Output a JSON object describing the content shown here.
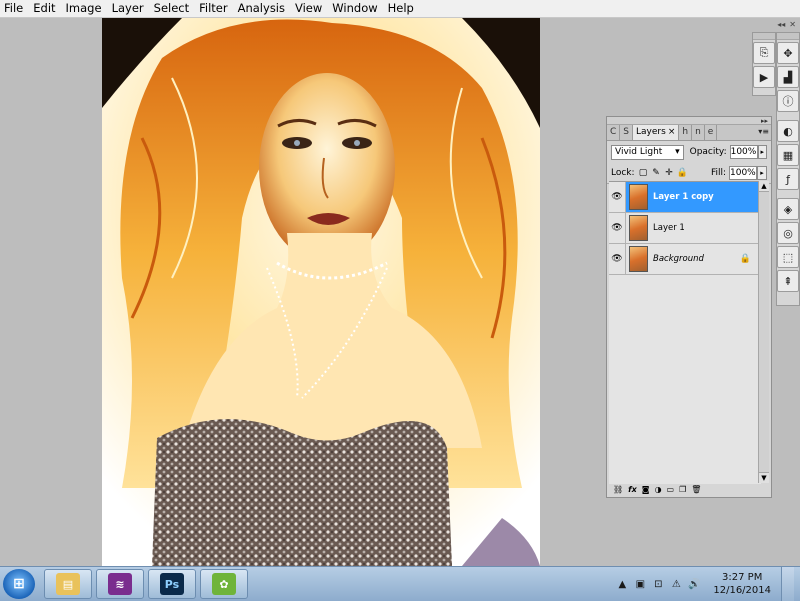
{
  "menu": [
    "File",
    "Edit",
    "Image",
    "Layer",
    "Select",
    "Filter",
    "Analysis",
    "View",
    "Window",
    "Help"
  ],
  "dock_top": {
    "collapse_icon": "double-arrow-left",
    "close_icon": "close"
  },
  "dock_left_icons": [
    "history-icon",
    "actions-icon"
  ],
  "dock_right_icons": [
    "navigator-icon",
    "histogram-icon",
    "info-icon",
    "swatches-icon",
    "styles-icon",
    "adjustments-icon",
    "masks-icon",
    "clone-source-icon",
    "paths-icon",
    "tool-presets-icon"
  ],
  "layers_panel": {
    "tabs": [
      {
        "label": "C"
      },
      {
        "label": "S"
      },
      {
        "label": "Layers",
        "active": true
      },
      {
        "label": "h"
      },
      {
        "label": "n"
      },
      {
        "label": "e"
      }
    ],
    "blend_mode": "Vivid Light",
    "opacity_label": "Opacity:",
    "opacity_value": "100%",
    "lock_label": "Lock:",
    "fill_label": "Fill:",
    "fill_value": "100%",
    "layers": [
      {
        "name": "Layer 1 copy",
        "selected": true,
        "visible": true,
        "locked": false,
        "italic": false
      },
      {
        "name": "Layer 1",
        "selected": false,
        "visible": true,
        "locked": false,
        "italic": false
      },
      {
        "name": "Background",
        "selected": false,
        "visible": true,
        "locked": true,
        "italic": true
      }
    ],
    "footer_icons": [
      "link-layers-icon",
      "fx-icon",
      "add-mask-icon",
      "adjustment-layer-icon",
      "group-icon",
      "new-layer-icon",
      "trash-icon"
    ]
  },
  "taskbar": {
    "apps": [
      "explorer",
      "library",
      "photoshop",
      "corel"
    ],
    "photoshop_label": "Ps",
    "time": "3:27 PM",
    "date": "12/16/2014"
  },
  "colors": {
    "selected_layer": "#3399ff",
    "panel_bg": "#d6d6d6",
    "workspace": "#bdbdbd"
  }
}
